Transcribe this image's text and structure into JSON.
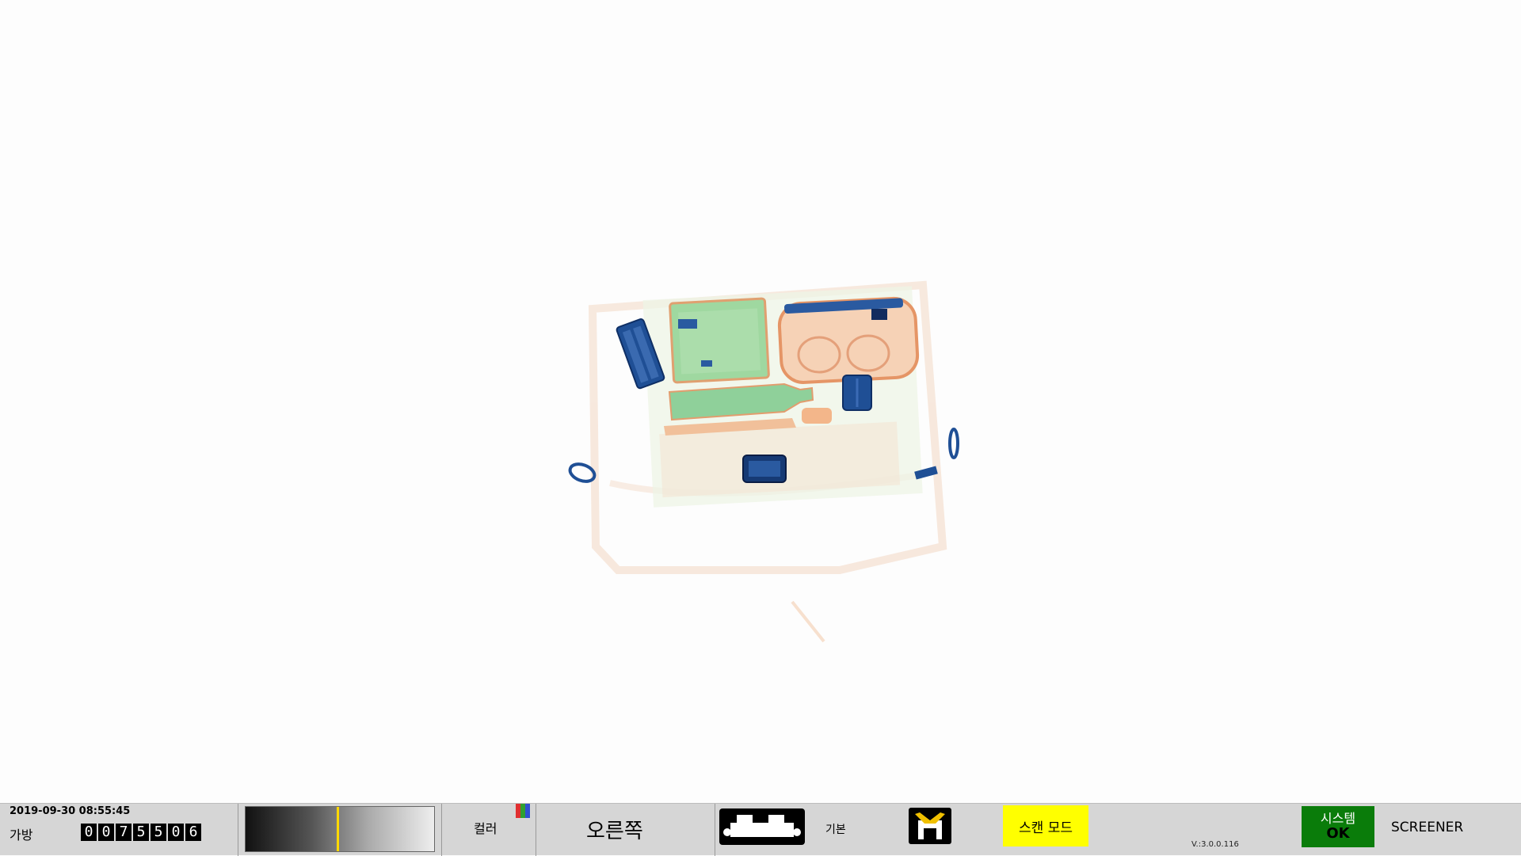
{
  "status_bar": {
    "datetime": "2019-09-30 08:55:45",
    "bag_label": "가방",
    "bag_counter": [
      "0",
      "0",
      "7",
      "5",
      "5",
      "0",
      "6"
    ],
    "gradient_marker_level": 0.49,
    "color_mode_label": "컬러",
    "color_icon_colors": [
      "#e03030",
      "#30a030",
      "#3050d0"
    ],
    "view_side_label": "오른쪽",
    "mode_icon": "conveyor-machine-icon",
    "base_label": "기본",
    "save_icon": "save-disk-icon",
    "scan_mode_label": "스캔 모드",
    "scan_mode_color": "#ffff00",
    "version": "V.:3.0.0.116",
    "system_label": "시스템",
    "system_status": "OK",
    "system_status_color": "#0a7c0a",
    "user_role": "SCREENER"
  },
  "xray_image": {
    "palette": {
      "organic": "#e8a070",
      "inorganic": "#70c080",
      "metal": "#1a4a90"
    }
  }
}
